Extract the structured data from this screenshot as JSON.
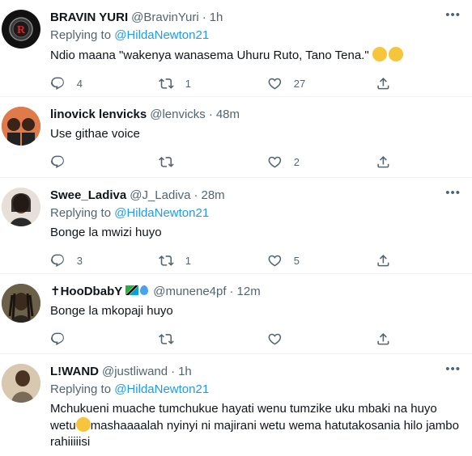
{
  "icons": [
    "more-icon",
    "reply-icon",
    "retweet-icon",
    "like-icon",
    "share-icon"
  ],
  "colors": {
    "link": "#1d9bf0",
    "secondary": "#536471",
    "text": "#0f1419",
    "divider": "#eff3f4"
  },
  "tweets": [
    {
      "name": "BRAVIN YURI",
      "handle": "@BravinYuri",
      "sep": "·",
      "time": "1h",
      "replying_prefix": "Replying to ",
      "replying_to": "@HildaNewton21",
      "text": "Ndio maana \"wakenya wanasema Uhuru Ruto, Tano Tena.\" ",
      "emojis": [
        "face-with-tears-of-joy",
        "face-with-tears-of-joy"
      ],
      "replies": "4",
      "retweets": "1",
      "likes": "27"
    },
    {
      "name": "linovick lenvicks",
      "handle": "@lenvicks",
      "sep": "·",
      "time": "48m",
      "text": "Use githae voice",
      "replies": "",
      "retweets": "",
      "likes": "2"
    },
    {
      "name": "Swee_Ladiva",
      "handle": "@J_Ladiva",
      "sep": "·",
      "time": "28m",
      "replying_prefix": "Replying to ",
      "replying_to": "@HildaNewton21",
      "text": "Bonge la mwizi huyo",
      "replies": "3",
      "retweets": "1",
      "likes": "5"
    },
    {
      "name": "✝HooDbabY",
      "name_emojis": [
        "flag-tanzania",
        "droplet"
      ],
      "handle": "@munene4pf",
      "sep": "·",
      "time": "12m",
      "text": "Bonge la mkopaji huyo",
      "replies": "",
      "retweets": "",
      "likes": ""
    },
    {
      "name": "L!WAND",
      "handle": "@justliwand",
      "sep": "·",
      "time": "1h",
      "replying_prefix": "Replying to ",
      "replying_to": "@HildaNewton21",
      "text_a": "Mchukueni muache tumchukue hayati wenu tumzike uku mbaki na huyo wetu",
      "emojis": [
        "smiling-face-with-smiling-eyes"
      ],
      "text_b": "mashaaaalah nyinyi ni majirani wetu wema hatutakosania hilo jambo rahiiiiisi"
    }
  ]
}
